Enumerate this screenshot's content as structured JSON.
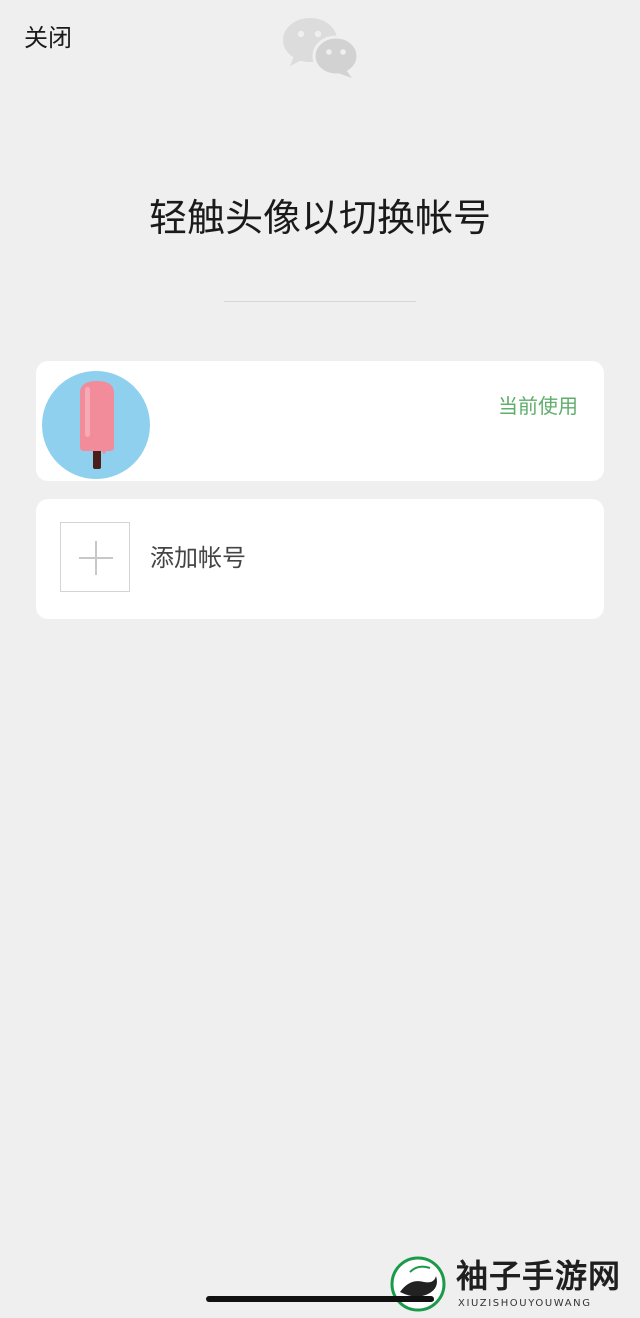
{
  "header": {
    "close_label": "关闭",
    "logo_icon": "wechat-icon"
  },
  "main": {
    "title": "轻触头像以切换帐号"
  },
  "accounts": [
    {
      "name": "",
      "avatar_icon": "popsicle-avatar",
      "status_label": "当前使用",
      "status_color": "#5fae6b"
    }
  ],
  "add_account": {
    "icon": "plus-icon",
    "label": "添加帐号"
  },
  "watermark": {
    "icon": "bird-logo-icon",
    "text_cn": "袖子手游网",
    "text_en": "XIUZISHOUYOUWANG"
  },
  "colors": {
    "background": "#efefef",
    "card": "#ffffff",
    "accent_green": "#5fae6b",
    "avatar_bg": "#8fd0ef",
    "popsicle": "#f28b9a"
  }
}
